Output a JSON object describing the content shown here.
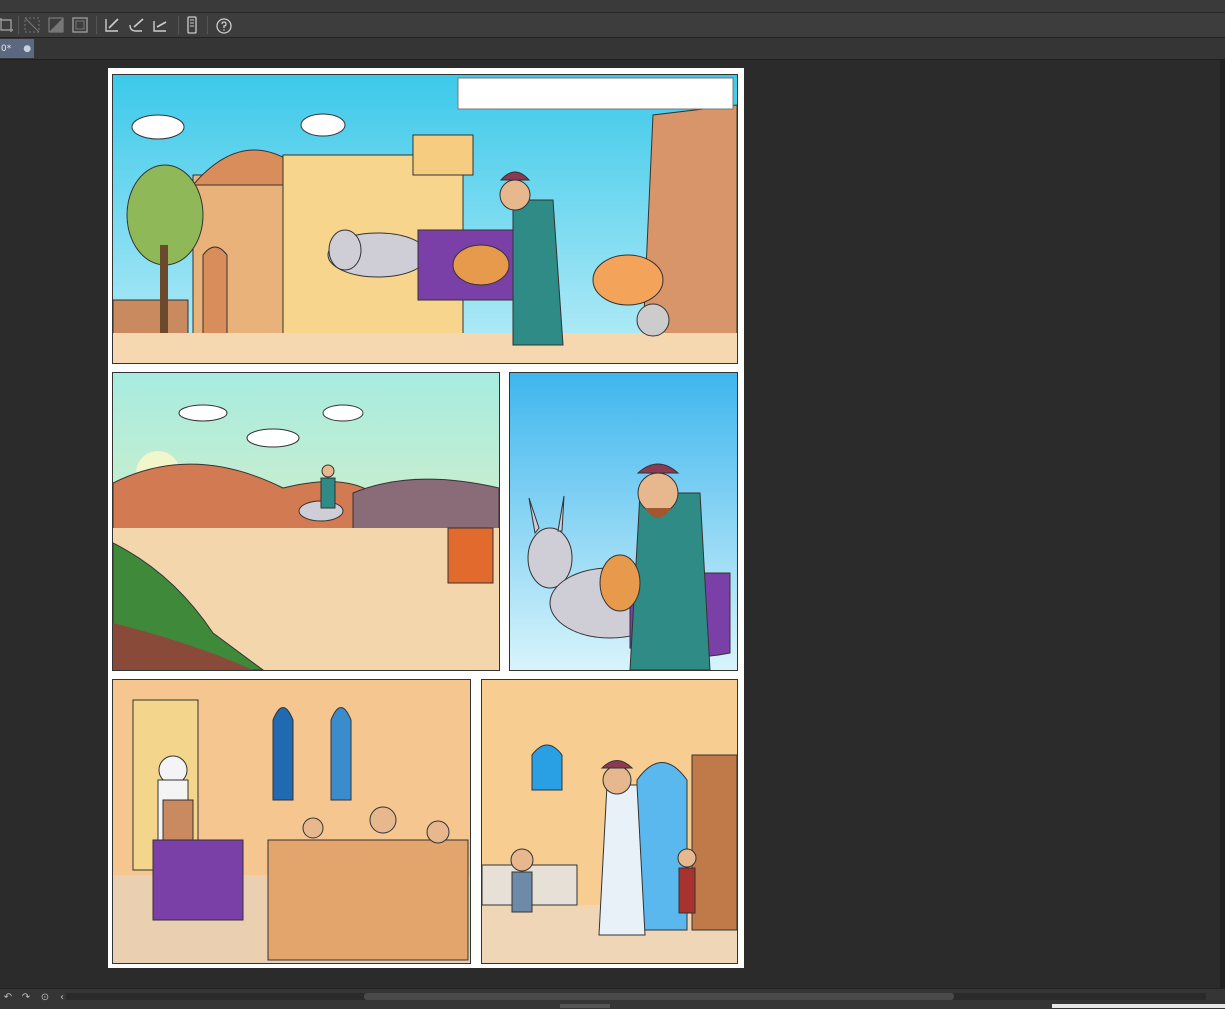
{
  "document": {
    "tab_label": "0*",
    "tab_dot": "●"
  },
  "toolbar": {
    "icons": [
      "crop-icon",
      "grid-off-icon",
      "grid-diagonal-icon",
      "frame-icon",
      "ruler-pen-icon",
      "curve-ruler-icon",
      "symmetry-ruler-icon",
      "device-icon",
      "help-icon"
    ]
  },
  "statusbar": {
    "icons": [
      "rotate-left-icon",
      "rotate-right-icon",
      "reset-icon",
      "scroll-left-icon"
    ]
  },
  "colors": {
    "sky": "#5fd0ef",
    "desert": "#f4cfa2",
    "teal_robe": "#2e8b86",
    "purple_cloth": "#7b3fa8",
    "donkey": "#cfcdd6"
  }
}
